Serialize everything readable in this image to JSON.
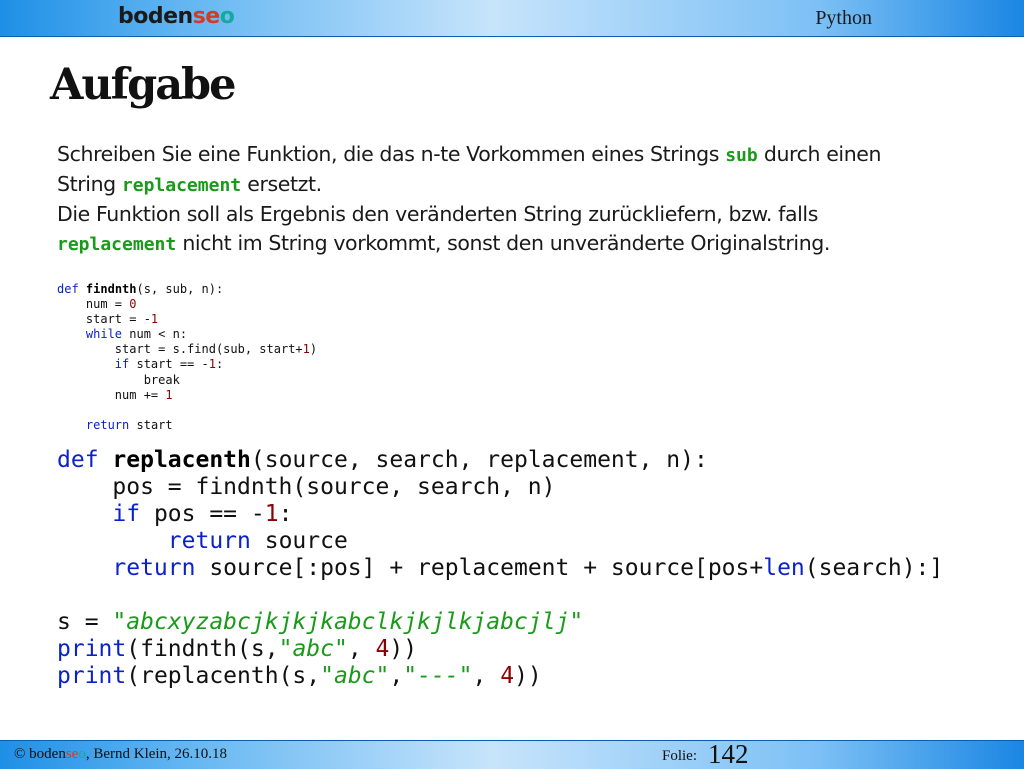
{
  "header": {
    "logo": {
      "part1": "boden",
      "part2": "se",
      "part3": "o"
    },
    "title": "Python"
  },
  "slide": {
    "heading": "Aufgabe",
    "paragraph": {
      "p1": "Schreiben Sie eine Funktion, die das n-te Vorkommen eines Strings ",
      "sub": "sub",
      "p2": " durch einen",
      "p3": "String ",
      "replacement1": "replacement",
      "p4": " ersetzt.",
      "p5": "Die Funktion soll als Ergebnis den veränderten String zurückliefern, bzw. falls",
      "replacement2": "replacement",
      "p6": " nicht im String vorkommt, sonst den unveränderte Originalstring."
    },
    "code_small": [
      "def findnth(s, sub, n):",
      "    num = 0",
      "    start = -1",
      "    while num < n:",
      "        start = s.find(sub, start+1)",
      "        if start == -1:",
      "            break",
      "        num += 1",
      "",
      "    return start"
    ],
    "code_big": [
      "def replacenth(source, search, replacement, n):",
      "    pos = findnth(source, search, n)",
      "    if pos == -1:",
      "        return source",
      "    return source[:pos] + replacement + source[pos+len(search):]",
      "",
      "s = \"abcxyzabcjkjkjkabclkjkjlkjabcjlj\"",
      "print(findnth(s,\"abc\", 4))",
      "print(replacenth(s,\"abc\",\"---\", 4))"
    ]
  },
  "footer": {
    "copyright": "© ",
    "logo": {
      "part1": "boden",
      "part2": "se",
      "part3": "o"
    },
    "author_date": ", Bernd Klein, 26.10.18",
    "folie_label": "Folie:",
    "slide_number": "142"
  }
}
